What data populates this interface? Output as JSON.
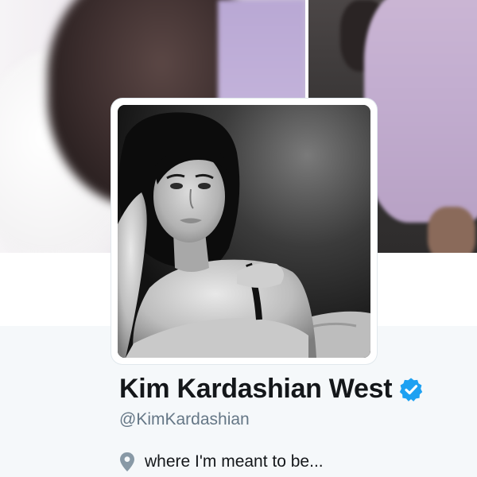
{
  "profile": {
    "display_name": "Kim Kardashian West",
    "handle": "@KimKardashian",
    "location": "where I'm meant to be...",
    "verified": true
  },
  "icons": {
    "verified": "verified-badge-icon",
    "location": "location-pin-icon"
  },
  "colors": {
    "verified_blue": "#1da1f2",
    "name_text": "#14171a",
    "handle_text": "#657786",
    "icon_gray": "#8899a6",
    "background": "#f5f8fa"
  }
}
